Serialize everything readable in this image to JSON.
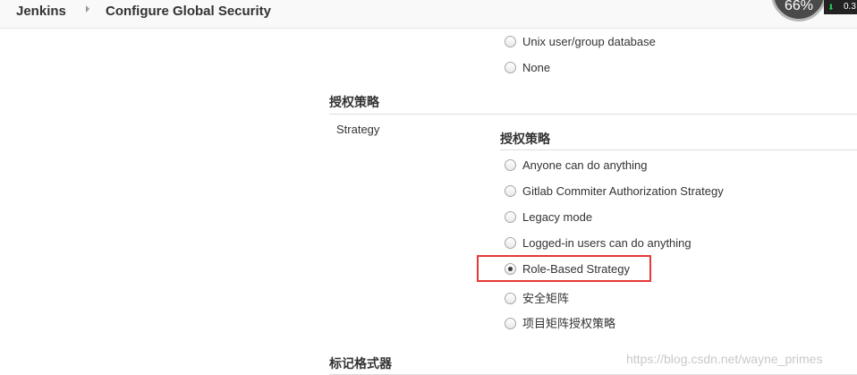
{
  "breadcrumb": {
    "root": "Jenkins",
    "current": "Configure Global Security"
  },
  "overlay": {
    "widget_text": "66%",
    "net_value": "0.3"
  },
  "security_realm": {
    "options": [
      {
        "label": "Unix user/group database",
        "checked": false
      },
      {
        "label": "None",
        "checked": false
      }
    ]
  },
  "authorization": {
    "section_title": "授权策略",
    "field_label": "Strategy",
    "inner_title": "授权策略",
    "options": [
      {
        "label": "Anyone can do anything",
        "checked": false
      },
      {
        "label": "Gitlab Commiter Authorization Strategy",
        "checked": false
      },
      {
        "label": "Legacy mode",
        "checked": false
      },
      {
        "label": "Logged-in users can do anything",
        "checked": false
      },
      {
        "label": "Role-Based Strategy",
        "checked": true
      },
      {
        "label": "安全矩阵",
        "checked": false
      },
      {
        "label": "项目矩阵授权策略",
        "checked": false
      }
    ]
  },
  "markup_formatter": {
    "section_title": "标记格式器"
  },
  "watermark": "https://blog.csdn.net/wayne_primes",
  "colors": {
    "highlight": "#e53935",
    "topbar": "#f9f9f9"
  }
}
